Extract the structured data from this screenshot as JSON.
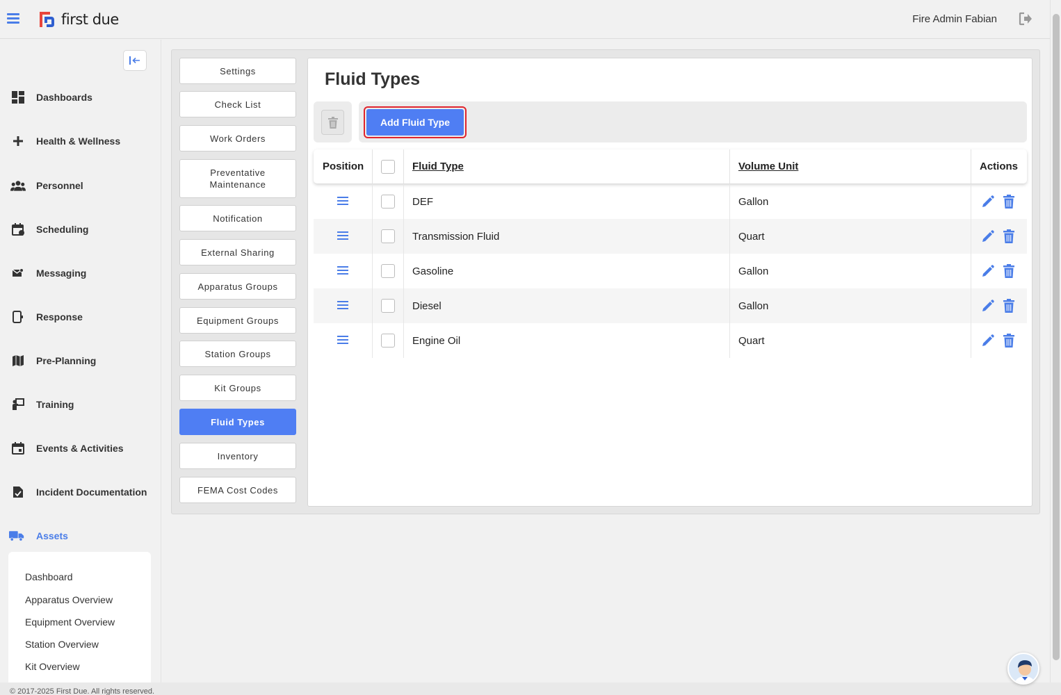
{
  "app": {
    "logo_text": "first due",
    "user_name": "Fire Admin Fabian"
  },
  "colors": {
    "accent": "#4f7ef3",
    "highlight_border": "#e0242e"
  },
  "leftnav": {
    "items": [
      {
        "label": "Dashboards",
        "icon": "dashboard-icon"
      },
      {
        "label": "Health & Wellness",
        "icon": "plus-icon"
      },
      {
        "label": "Personnel",
        "icon": "people-icon"
      },
      {
        "label": "Scheduling",
        "icon": "calendar-icon"
      },
      {
        "label": "Messaging",
        "icon": "mail-icon"
      },
      {
        "label": "Response",
        "icon": "response-icon"
      },
      {
        "label": "Pre-Planning",
        "icon": "map-icon"
      },
      {
        "label": "Training",
        "icon": "training-icon"
      },
      {
        "label": "Events & Activities",
        "icon": "event-icon"
      },
      {
        "label": "Incident Documentation",
        "icon": "document-icon"
      },
      {
        "label": "Assets",
        "icon": "truck-icon"
      }
    ],
    "sub_items": [
      "Dashboard",
      "Apparatus Overview",
      "Equipment Overview",
      "Station Overview",
      "Kit Overview"
    ]
  },
  "settings_menu": [
    "Settings",
    "Check List",
    "Work Orders",
    "Preventative Maintenance",
    "Notification",
    "External Sharing",
    "Apparatus Groups",
    "Equipment Groups",
    "Station Groups",
    "Kit Groups",
    "Fluid Types",
    "Inventory",
    "FEMA Cost Codes"
  ],
  "panel": {
    "title": "Fluid Types",
    "add_button": "Add Fluid Type",
    "columns": {
      "position": "Position",
      "fluid_type": "Fluid Type",
      "volume_unit": "Volume Unit",
      "actions": "Actions"
    },
    "rows": [
      {
        "fluid_type": "DEF",
        "volume_unit": "Gallon"
      },
      {
        "fluid_type": "Transmission Fluid",
        "volume_unit": "Quart"
      },
      {
        "fluid_type": "Gasoline",
        "volume_unit": "Gallon"
      },
      {
        "fluid_type": "Diesel",
        "volume_unit": "Gallon"
      },
      {
        "fluid_type": "Engine Oil",
        "volume_unit": "Quart"
      }
    ]
  },
  "footer": {
    "text": "© 2017-2025 First Due. All rights reserved."
  }
}
